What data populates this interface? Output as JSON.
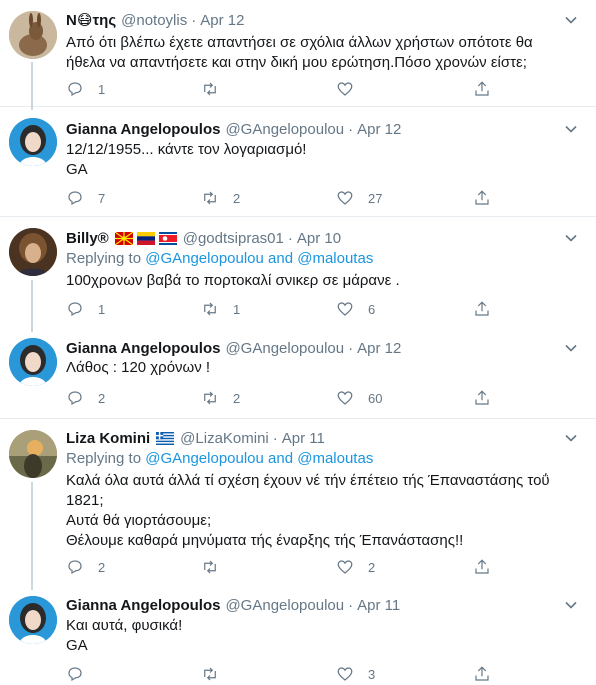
{
  "colors": {
    "accent": "#1b95e0",
    "muted": "#657786",
    "text": "#14171a",
    "separator": "#e6ecf0",
    "thread": "#ccd6dd"
  },
  "tweets": [
    {
      "name": "N😷της",
      "handle": "@notoylis",
      "sep": "·",
      "time": "Apr 12",
      "lines": [
        "Από ότι βλέπω έχετε απαντήσει σε σχόλια άλλων χρήστων οπότοτε θα",
        "ήθελα να απαντήσετε και στην δική μου ερώτηση.Πόσο χρονών είστε;"
      ],
      "replies": "1",
      "retweets": "",
      "likes": ""
    },
    {
      "name": "Gianna Angelopoulos",
      "handle": "@GAngelopoulou",
      "sep": "·",
      "time": "Apr 12",
      "lines": [
        "12/12/1955... κάντε τον λογαριασμό!",
        "GA"
      ],
      "replies": "7",
      "retweets": "2",
      "likes": "27"
    },
    {
      "name": "Billy®",
      "handle": "@godtsipras01",
      "sep": "·",
      "time": "Apr 10",
      "replying_prefix": "Replying to",
      "replying_users": "@GAngelopoulou and @maloutas",
      "lines": [
        "100χρονων βαβά το πορτοκαλί σνικερ σε μάρανε ."
      ],
      "replies": "1",
      "retweets": "1",
      "likes": "6"
    },
    {
      "name": "Gianna Angelopoulos",
      "handle": "@GAngelopoulou",
      "sep": "·",
      "time": "Apr 12",
      "lines": [
        "Λάθος : 120 χρόνων !"
      ],
      "replies": "2",
      "retweets": "2",
      "likes": "60"
    },
    {
      "name": "Liza Komini",
      "handle": "@LizaKomini",
      "sep": "·",
      "time": "Apr 11",
      "replying_prefix": "Replying to",
      "replying_users": "@GAngelopoulou and @maloutas",
      "lines": [
        "Καλά όλα αυτά άλλά τί σχέση έχουν νέ τήν έπέτειο τής Έπαναστάσης τοΰ",
        "1821;",
        "Αυτά θά γιορτάσουμε;",
        "Θέλουμε καθαρά μηνύματα τής έναρξης τής Έπανάστασης!!"
      ],
      "replies": "2",
      "retweets": "",
      "likes": "2"
    },
    {
      "name": "Gianna Angelopoulos",
      "handle": "@GAngelopoulou",
      "sep": "·",
      "time": "Apr 11",
      "lines": [
        "Και αυτά, φυσικά!",
        "GA"
      ],
      "replies": "",
      "retweets": "",
      "likes": "3"
    }
  ]
}
